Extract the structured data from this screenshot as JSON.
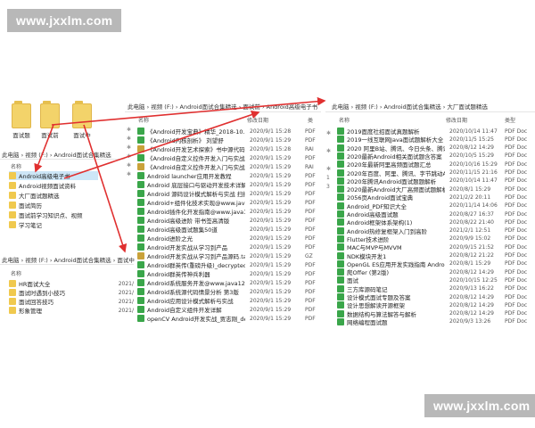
{
  "watermarks": {
    "top": "www.jxxlm.com",
    "bottom": "www.jxxlm.com"
  },
  "big_folders": [
    {
      "label": "面试题"
    },
    {
      "label": "面试前"
    },
    {
      "label": "面试中"
    }
  ],
  "left_panel": {
    "breadcrumb": "此电脑 › 视频 (F:) › Android面试合集精选",
    "col_name": "名称",
    "items": [
      {
        "name": "Android高级电子书"
      },
      {
        "name": "Android视频面试资料"
      },
      {
        "name": "大厂面试题精选"
      },
      {
        "name": "面试简历"
      },
      {
        "name": "面试前学习知识点、视频"
      },
      {
        "name": "学习笔记"
      }
    ]
  },
  "bottom_left_panel": {
    "breadcrumb": "此电脑 › 视频 (F:) › Android面试合集精选 › 面试中",
    "col_name": "名称",
    "items": [
      {
        "name": "HR面试大全",
        "date": "2021/"
      },
      {
        "name": "面试时遇到小技巧",
        "date": "2021/"
      },
      {
        "name": "面试回答技巧",
        "date": "2021/"
      },
      {
        "name": "形象管理",
        "date": "2021/"
      }
    ]
  },
  "middle_panel": {
    "breadcrumb": "此电脑 › 视频 (F:) › Android面试合集精选 › 面试前 › Android高级电子书",
    "col_name": "名称",
    "col_date": "修改日期",
    "col_type": "类",
    "items": [
      {
        "name": "《Android开发宝典》精华_2018-10...",
        "date": "2020/9/1 15:28",
        "type": "PDF",
        "kind": "pdf"
      },
      {
        "name": "《Android内核剖析》 刘望舒",
        "date": "2020/9/1 15:29",
        "type": "PDF",
        "kind": "pdf"
      },
      {
        "name": "《Android开发艺术探索》书中源代码",
        "date": "2020/9/1 15:28",
        "type": "RAI",
        "kind": "zip"
      },
      {
        "name": "《Android自定义控件开发入门与实战》",
        "date": "2020/9/1 15:29",
        "type": "PDF",
        "kind": "pdf"
      },
      {
        "name": "《Android自定义控件开发入门与实战》源码",
        "date": "2020/9/1 15:29",
        "type": "RAI",
        "kind": "zip"
      },
      {
        "name": "Android launcher应用开发教程",
        "date": "2020/9/1 15:29",
        "type": "PDF",
        "kind": "pdf"
      },
      {
        "name": "Android 底层接口与驱动开发技术详解",
        "date": "2020/9/1 15:29",
        "type": "PDF",
        "kind": "pdf"
      },
      {
        "name": "Android 源码设计模式解析与实战 扫描版",
        "date": "2020/9/1 15:29",
        "type": "PDF",
        "kind": "pdf"
      },
      {
        "name": "Android+组件化技术实现@www.java1234...",
        "date": "2020/9/1 15:29",
        "type": "PDF",
        "kind": "pdf"
      },
      {
        "name": "Android插件化开发指南@www.java123...",
        "date": "2020/9/1 15:29",
        "type": "PDF",
        "kind": "pdf"
      },
      {
        "name": "Android高级进阶 带书签高清版",
        "date": "2020/9/1 15:29",
        "type": "PDF",
        "kind": "pdf"
      },
      {
        "name": "Android高级面试题集50道",
        "date": "2020/9/1 15:29",
        "type": "PDF",
        "kind": "pdf"
      },
      {
        "name": "Android进阶之光",
        "date": "2020/9/1 15:29",
        "type": "PDF",
        "kind": "pdf"
      },
      {
        "name": "Android开发实战从学习到产品",
        "date": "2020/9/1 15:29",
        "type": "PDF",
        "kind": "pdf"
      },
      {
        "name": "Android开发实战从学习到产品源码.tar",
        "date": "2020/9/1 15:29",
        "type": "GZ",
        "kind": "zip"
      },
      {
        "name": "Android群英传(重磅升级)_decrypted",
        "date": "2020/9/1 15:29",
        "type": "PDF",
        "kind": "pdf"
      },
      {
        "name": "Android群英传神兵利器",
        "date": "2020/9/1 15:29",
        "type": "PDF",
        "kind": "pdf"
      },
      {
        "name": "Android系统服务开发@www.java1234...",
        "date": "2020/9/1 15:29",
        "type": "PDF",
        "kind": "pdf"
      },
      {
        "name": "Android系统源代码情景分析 第3版",
        "date": "2020/9/1 15:29",
        "type": "PDF",
        "kind": "pdf"
      },
      {
        "name": "Android应用设计模式解析与实战",
        "date": "2020/9/1 15:29",
        "type": "PDF",
        "kind": "pdf"
      },
      {
        "name": "Android自定义组件开发详解",
        "date": "2020/9/1 15:29",
        "type": "PDF",
        "kind": "pdf"
      },
      {
        "name": "openCV Android开发实战_贾志刚_dec...",
        "date": "2020/9/1 15:29",
        "type": "PDF",
        "kind": "pdf"
      }
    ]
  },
  "right_panel": {
    "breadcrumb": "此电脑 › 视频 (F:) › Android面试合集精选 › 大厂面试题精选",
    "col_name": "名称",
    "col_date": "修改日期",
    "col_type": "类型",
    "items": [
      {
        "name": "2019面度社招面试真题解析",
        "date": "2020/10/14 11:47",
        "type": "PDF Doc",
        "kind": "pdf"
      },
      {
        "name": "2019一线互联网Java面试题解析大全",
        "date": "2020/11/5 15:25",
        "type": "PDF Doc",
        "kind": "pdf"
      },
      {
        "name": "2020 阿里B站、腾讯、今日头条、腾讯...",
        "date": "2020/8/12 14:29",
        "type": "PDF Doc",
        "kind": "pdf"
      },
      {
        "name": "2020最新Android相关面试题含答案",
        "date": "2020/10/5 15:29",
        "type": "PDF Doc",
        "kind": "pdf"
      },
      {
        "name": "2020年最新阿里高频面试题汇总",
        "date": "2020/10/16 15:29",
        "type": "PDF Doc",
        "kind": "pdf"
      },
      {
        "name": "2020年百度、阿里、腾讯、字节跳动Andro...",
        "date": "2020/11/15 21:16",
        "type": "PDF Doc",
        "kind": "pdf"
      },
      {
        "name": "2020年腾讯Android面试题题解析",
        "date": "2020/10/14 11:47",
        "type": "PDF Doc",
        "kind": "pdf"
      },
      {
        "name": "2020最新Android大厂高频面试题解析大全",
        "date": "2020/8/1 15:29",
        "type": "PDF Doc",
        "kind": "pdf"
      },
      {
        "name": "2056页Android面试宝典",
        "date": "2021/2/2 20:11",
        "type": "PDF Doc",
        "kind": "pdf"
      },
      {
        "name": "Android_PDF知识大全",
        "date": "2020/11/14 14:06",
        "type": "PDF Doc",
        "kind": "pdf"
      },
      {
        "name": "Android高级面试题",
        "date": "2020/8/27 16:37",
        "type": "PDF Doc",
        "kind": "pdf"
      },
      {
        "name": "Android框架体系架构(1)",
        "date": "2020/8/22 21:40",
        "type": "PDF Doc",
        "kind": "pdf"
      },
      {
        "name": "Android热修复框架入门到高阶",
        "date": "2021/2/1 12:51",
        "type": "PDF Doc",
        "kind": "pdf"
      },
      {
        "name": "Flutter技术进阶",
        "date": "2020/9/9 15:02",
        "type": "PDF Doc",
        "kind": "pdf"
      },
      {
        "name": "MAC与MVP与MVVM",
        "date": "2020/9/15 21:52",
        "type": "PDF Doc",
        "kind": "pdf"
      },
      {
        "name": "NDK模块开发1",
        "date": "2020/8/12 21:22",
        "type": "PDF Doc",
        "kind": "pdf"
      },
      {
        "name": "OpenGL ES应用开发实践指南 Android...",
        "date": "2020/8/1 15:29",
        "type": "PDF Doc",
        "kind": "pdf"
      },
      {
        "name": "爬Offer (第2版)",
        "date": "2020/8/12 14:29",
        "type": "PDF Doc",
        "kind": "pdf"
      },
      {
        "name": "面试",
        "date": "2020/10/15 12:25",
        "type": "PDF Doc",
        "kind": "pdf"
      },
      {
        "name": "三方库源码笔记",
        "date": "2020/9/13 16:22",
        "type": "PDF Doc",
        "kind": "pdf"
      },
      {
        "name": "设计模式面试专题及答案",
        "date": "2020/8/12 14:29",
        "type": "PDF Doc",
        "kind": "pdf"
      },
      {
        "name": "设计思想解读开源框架",
        "date": "2020/8/12 14:29",
        "type": "PDF Doc",
        "kind": "pdf"
      },
      {
        "name": "数据结构与算法解答与解析",
        "date": "2020/8/12 14:29",
        "type": "PDF Doc",
        "kind": "pdf"
      },
      {
        "name": "网络编程面试题",
        "date": "2020/9/3 13:26",
        "type": "PDF Doc",
        "kind": "pdf"
      }
    ]
  },
  "colors": {
    "arrow": "#e03030",
    "selected": "#cde6f7",
    "pdf_icon": "#3aa64a"
  }
}
